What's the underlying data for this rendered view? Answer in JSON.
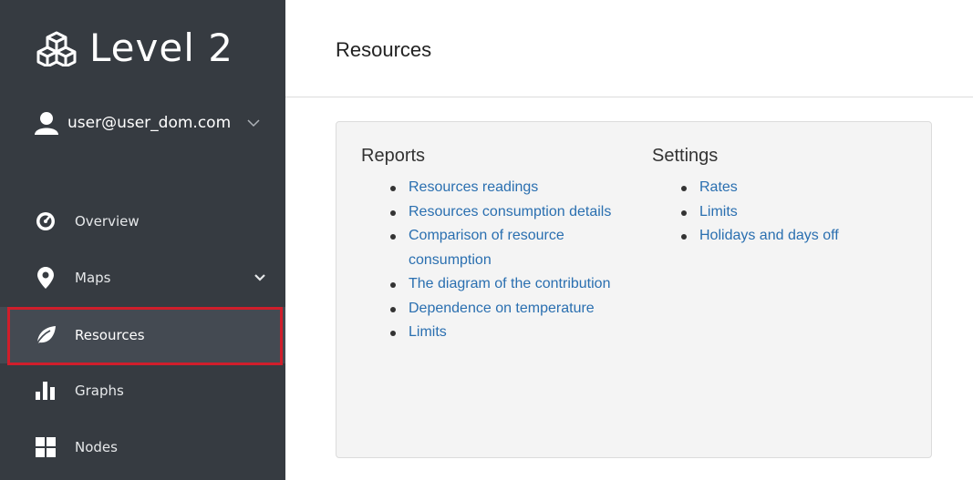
{
  "sidebar": {
    "brand": "Level 2",
    "user": "user@user_dom.com",
    "items": [
      {
        "label": "Overview",
        "icon": "dashboard-icon"
      },
      {
        "label": "Maps",
        "icon": "map-pin-icon"
      },
      {
        "label": "Resources",
        "icon": "leaf-icon",
        "active": true
      },
      {
        "label": "Graphs",
        "icon": "bar-chart-icon"
      },
      {
        "label": "Nodes",
        "icon": "grid-icon"
      }
    ]
  },
  "header": {
    "title": "Resources"
  },
  "reports": {
    "title": "Reports",
    "links": [
      "Resources readings",
      "Resources consumption details",
      "Comparison of resource consumption",
      "The diagram of the contribution",
      "Dependence on temperature",
      "Limits"
    ]
  },
  "settings": {
    "title": "Settings",
    "links": [
      "Rates",
      "Limits",
      "Holidays and days off"
    ]
  },
  "colors": {
    "sidebar_bg": "#363b41",
    "active_bg": "#444a52",
    "highlight": "#d01e2b",
    "link": "#2a6fb0"
  }
}
